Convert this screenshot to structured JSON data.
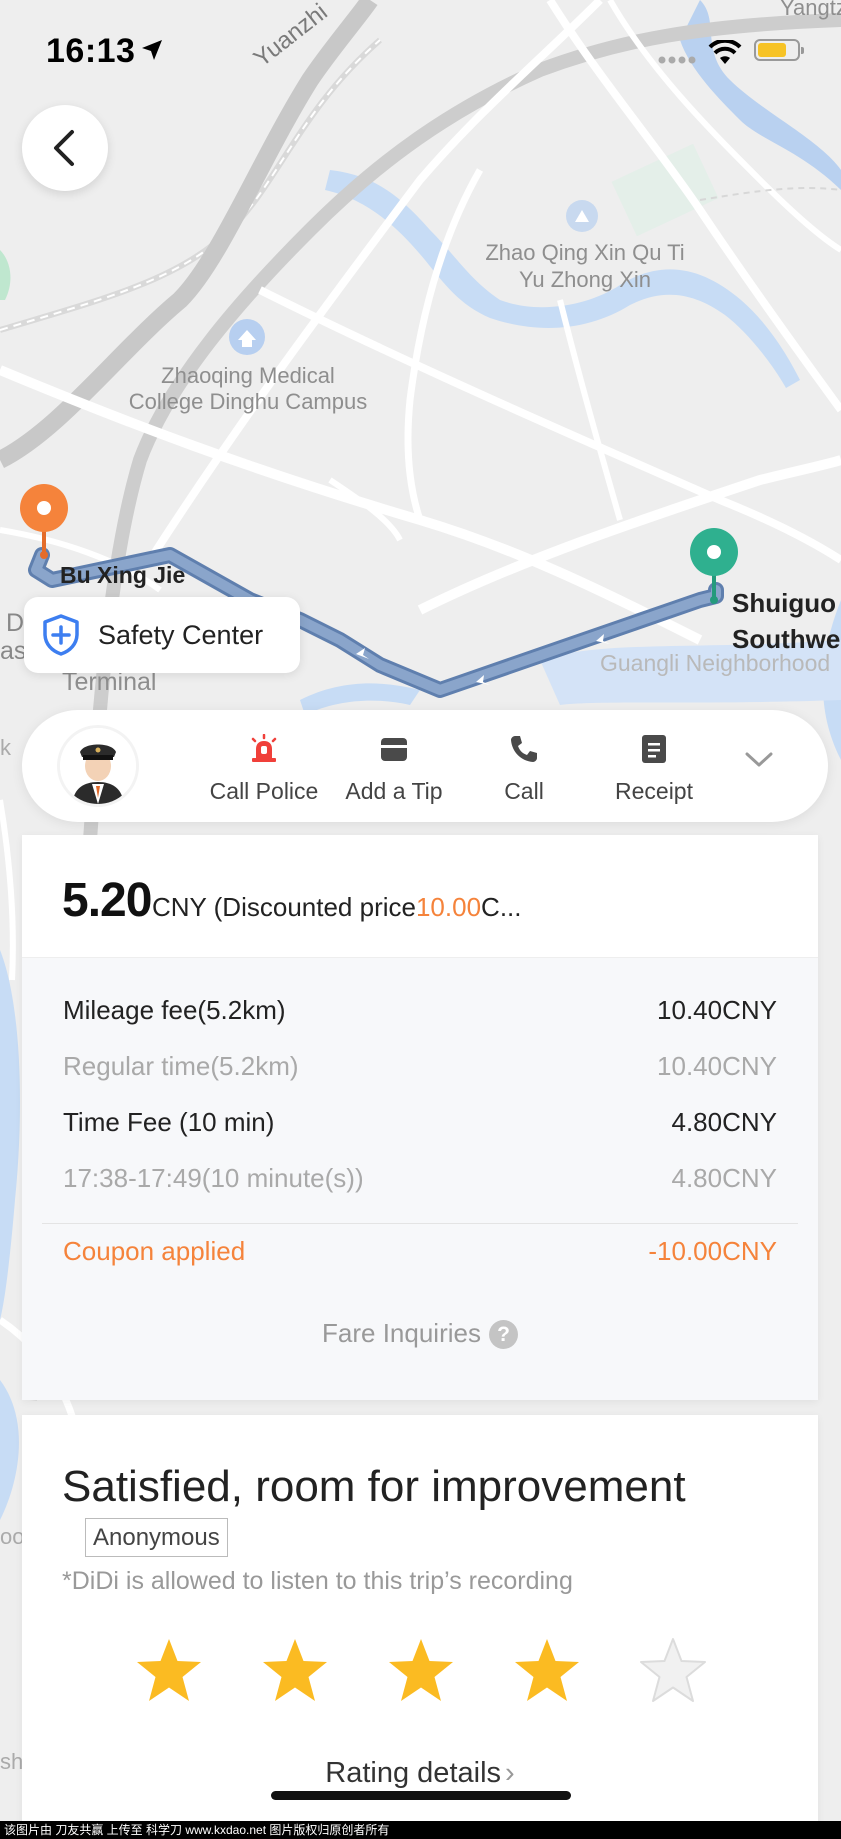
{
  "status_bar": {
    "time": "16:13"
  },
  "map": {
    "labels": {
      "yuanzhi": "Yuanzhi",
      "yangtze": "Yangtz",
      "zhao_qing_1": "Zhao Qing Xin Qu Ti",
      "zhao_qing_2": "Yu Zhong Xin",
      "college_1": "Zhaoqing Medical",
      "college_2": "College Dinghu Campus",
      "origin": "Bu Xing Jie",
      "destination_1": "Shuiguo",
      "destination_2": "Southwe",
      "neighborhood": "Guangli Neighborhood",
      "terminal": "Terminal",
      "edge_d": "D",
      "edge_as": "as",
      "edge_k": "k",
      "edge_oo": "oo",
      "edge_sh": "sh"
    }
  },
  "safety_center": {
    "label": "Safety Center"
  },
  "actions": [
    {
      "label": "Call Police",
      "icon": "siren-icon"
    },
    {
      "label": "Add a Tip",
      "icon": "wallet-icon"
    },
    {
      "label": "Call",
      "icon": "phone-icon"
    },
    {
      "label": "Receipt",
      "icon": "receipt-icon"
    }
  ],
  "fare": {
    "amount": "5.20",
    "unit_prefix": "CNY (Discounted price",
    "discounted": "10.00",
    "unit_suffix": "C...",
    "rows": [
      {
        "label": "Mileage fee(5.2km)",
        "value": "10.40CNY",
        "style": "main"
      },
      {
        "label": "Regular time(5.2km)",
        "value": "10.40CNY",
        "style": "sub"
      },
      {
        "label": "Time Fee (10 min)",
        "value": "4.80CNY",
        "style": "main"
      },
      {
        "label": "17:38-17:49(10 minute(s))",
        "value": "4.80CNY",
        "style": "sub"
      }
    ],
    "coupon": {
      "label": "Coupon applied",
      "value": "-10.00CNY"
    },
    "inquiries": "Fare Inquiries",
    "inquiries_icon": "?"
  },
  "rating": {
    "title": "Satisfied, room for improvement",
    "anonymous": "Anonymous",
    "recording_note": "*DiDi is allowed to listen to this trip’s recording",
    "stars": 4,
    "max_stars": 5,
    "details": "Rating details",
    "details_chevron": "›"
  },
  "colors": {
    "accent_orange": "#f5833b",
    "origin_pin": "#f5833b",
    "destination_pin": "#2fb08f",
    "route": "#7e98bf",
    "star_active": "#fbbb22",
    "police_red": "#f0403a"
  },
  "watermark": "该图片由 刀友共赢 上传至 科学刀 www.kxdao.net 图片版权归原创者所有"
}
